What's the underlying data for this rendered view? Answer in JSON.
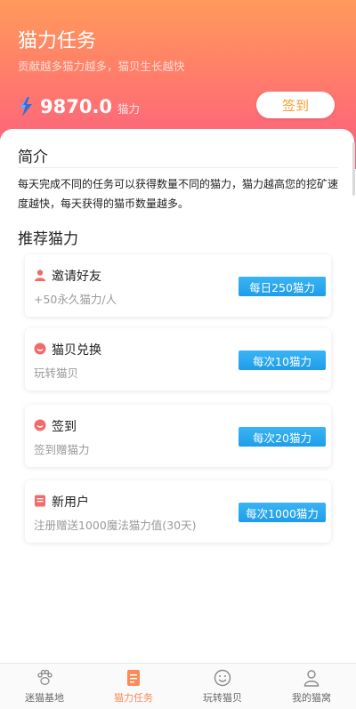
{
  "header": {
    "title": "猫力任务",
    "subtitle": "贡献越多猫力越多，猫贝生长越快",
    "balance_value": "9870.0",
    "balance_unit": "猫力",
    "signin_label": "签到"
  },
  "intro": {
    "title": "简介",
    "text": "每天完成不同的任务可以获得数量不同的猫力，猫力越高您的挖矿速度越快，每天获得的猫币数量越多。"
  },
  "recommend": {
    "title": "推荐猫力",
    "items": [
      {
        "title": "邀请好友",
        "desc": "+50永久猫力/人",
        "reward": "每日250猫力",
        "icon": "user-icon"
      },
      {
        "title": "猫贝兑换",
        "desc": "玩转猫贝",
        "reward": "每次10猫力",
        "icon": "smile-icon"
      },
      {
        "title": "签到",
        "desc": "签到赠猫力",
        "reward": "每次20猫力",
        "icon": "smile-icon"
      },
      {
        "title": "新用户",
        "desc": "注册赠送1000魔法猫力值(30天)",
        "reward": "每次1000猫力",
        "icon": "document-icon"
      }
    ]
  },
  "tabs": [
    {
      "label": "迷猫基地",
      "icon": "paw-icon",
      "active": false
    },
    {
      "label": "猫力任务",
      "icon": "task-icon",
      "active": true
    },
    {
      "label": "玩转猫贝",
      "icon": "smile-icon",
      "active": false
    },
    {
      "label": "我的猫窝",
      "icon": "person-icon",
      "active": false
    }
  ],
  "colors": {
    "header_top": "#ff9a5b",
    "header_bottom": "#fb5b83",
    "reward_badge": "#1e9de8",
    "active_tab": "#f98a5a",
    "signin_text": "#f4a034"
  }
}
